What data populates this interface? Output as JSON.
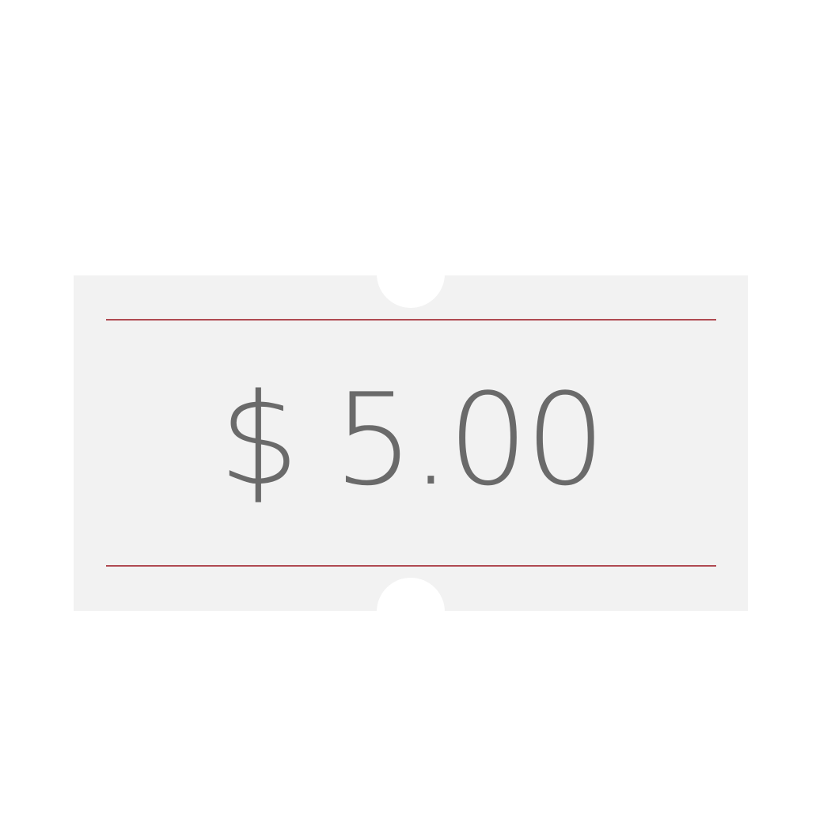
{
  "price_tag": {
    "price": "$ 5.00",
    "colors": {
      "tag_background": "#f2f2f2",
      "rule_line": "#b04a52",
      "price_text": "#6a6a6a"
    }
  }
}
